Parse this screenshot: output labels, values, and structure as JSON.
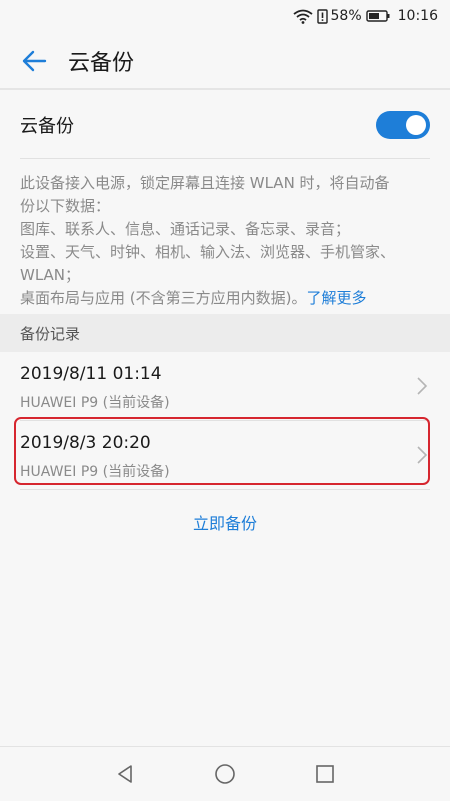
{
  "status_bar": {
    "wifi_icon": "wifi-icon",
    "battery_percent": "58%",
    "time": "10:16"
  },
  "app_bar": {
    "back_icon": "back-arrow-icon",
    "title": "云备份"
  },
  "setting": {
    "label": "云备份",
    "toggle_on": true,
    "toggle_color": "#1e7ed8"
  },
  "description": {
    "line1": "此设备接入电源，锁定屏幕且连接 WLAN 时，将自动备",
    "line2": "份以下数据：",
    "line3": "图库、联系人、信息、通话记录、备忘录、录音；",
    "line4": "设置、天气、时钟、相机、输入法、浏览器、手机管家、",
    "line5": "WLAN；",
    "line6": "桌面布局与应用 (不含第三方应用内数据)。",
    "learn_more": "了解更多"
  },
  "section": {
    "title": "备份记录"
  },
  "records": [
    {
      "date": "2019/8/11 01:14",
      "device": "HUAWEI P9 (当前设备)"
    },
    {
      "date": "2019/8/3 20:20",
      "device": "HUAWEI P9 (当前设备)"
    }
  ],
  "action": {
    "backup_now": "立即备份"
  },
  "nav": {
    "back": "nav-back-icon",
    "home": "nav-home-icon",
    "recents": "nav-recents-icon"
  },
  "colors": {
    "accent": "#1e7ed8",
    "highlight": "#d6262f"
  }
}
